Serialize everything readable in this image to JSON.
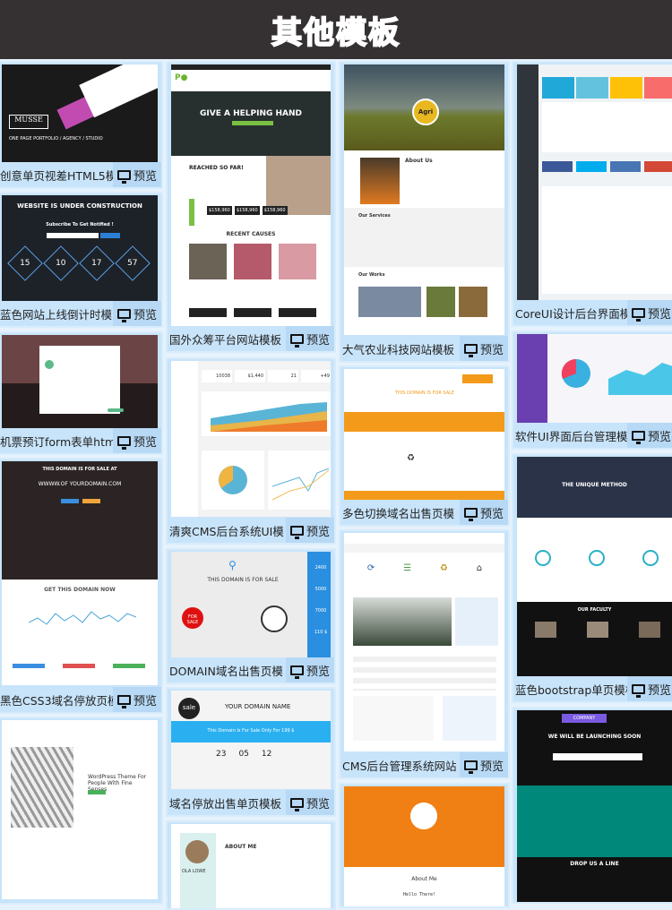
{
  "header": {
    "title": "其他模板"
  },
  "preview_label": "预览",
  "cards": [
    {
      "title": "创意单页视差HTML5模",
      "thumb": {
        "brand": "MUSSE",
        "tagline": "ONE PAGE PORTFOLIO / AGENCY / STUDIO"
      }
    },
    {
      "title": "蓝色网站上线倒计时模",
      "thumb": {
        "heading": "WEBSITE IS UNDER CONSTRUCTION",
        "subscribe": "Subscribe To Get Notified !",
        "countdown": [
          "15",
          "10",
          "17",
          "57"
        ]
      }
    },
    {
      "title": "机票预订form表单html",
      "thumb": {}
    },
    {
      "title": "黑色CSS3域名停放页模",
      "thumb": {
        "heading": "THIS DOMAIN IS FOR SALE AT",
        "domain": "WWWW.OF YOURDOMAIN.COM",
        "cta": "GET THIS DOMAIN NOW"
      }
    },
    {
      "title": "",
      "thumb": {
        "heading": "WordPress Theme For People With Fine Senses"
      }
    },
    {
      "title": "国外众筹平台网站模板",
      "thumb": {
        "heading": "GIVE A HELPING HAND",
        "reached": "REACHED SO FAR!",
        "amounts": [
          "$158,960",
          "$158,960",
          "$158,960"
        ],
        "recent": "RECENT CAUSES"
      }
    },
    {
      "title": "清爽CMS后台系统UI模",
      "thumb": {
        "stats": [
          "10038",
          "$1,440",
          "21",
          "+49"
        ]
      }
    },
    {
      "title": "DOMAIN域名出售页模",
      "thumb": {
        "heading": "THIS DOMAIN IS FOR SALE",
        "badge": "FOR SALE",
        "prices": [
          "2400",
          "5000",
          "7000",
          "110 $"
        ]
      }
    },
    {
      "title": "域名停放出售单页模板",
      "thumb": {
        "logo": "sale",
        "heading": "YOUR DOMAIN NAME",
        "banner": "This Domain Is For Sale Only For 199 $",
        "counts": [
          "23",
          "05",
          "12"
        ]
      }
    },
    {
      "title": "",
      "thumb": {
        "heading": "ABOUT ME",
        "name": "OLA LOWE"
      }
    },
    {
      "title": "大气农业科技网站模板",
      "thumb": {
        "logo": "Agri",
        "about": "About Us",
        "services": "Our Services",
        "works": "Our Works"
      }
    },
    {
      "title": "多色切换域名出售页模",
      "thumb": {
        "heading": "THIS DOMAIN IS FOR SALE"
      }
    },
    {
      "title": "CMS后台管理系统网站",
      "thumb": {}
    },
    {
      "title": "",
      "thumb": {
        "heading": "About Me",
        "hello": "Hello There!"
      }
    },
    {
      "title": "CoreUI设计后台界面模",
      "thumb": {}
    },
    {
      "title": "软件UI界面后台管理模",
      "thumb": {}
    },
    {
      "title": "蓝色bootstrap单页模板",
      "thumb": {
        "heading": "THE UNIQUE METHOD",
        "team": "OUR FACULTY"
      }
    },
    {
      "title": "",
      "thumb": {
        "brand": "COMPANY",
        "heading": "WE WILL BE LAUNCHING SOON",
        "drop": "DROP US A LINE"
      }
    }
  ]
}
